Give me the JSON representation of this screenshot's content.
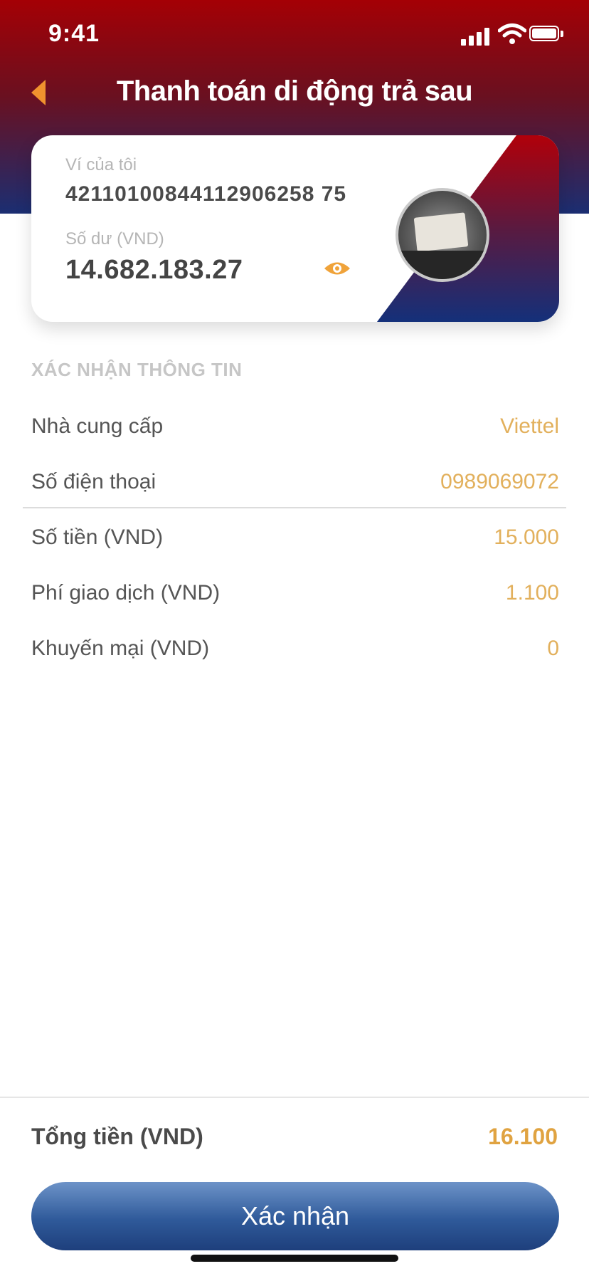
{
  "status": {
    "time": "9:41"
  },
  "nav": {
    "title": "Thanh toán di động trả sau"
  },
  "wallet": {
    "label": "Ví của tôi",
    "account_number": "42110100844112906258 75",
    "balance_label": "Số dư (VND)",
    "balance": "14.682.183.27"
  },
  "confirm_section": {
    "title": "XÁC NHẬN THÔNG TIN",
    "rows": [
      {
        "label": "Nhà cung cấp",
        "value": "Viettel"
      },
      {
        "label": "Số điện thoại",
        "value": "0989069072"
      },
      {
        "label": "Số tiền (VND)",
        "value": "15.000"
      },
      {
        "label": "Phí giao dịch (VND)",
        "value": "1.100"
      },
      {
        "label": "Khuyến mại (VND)",
        "value": "0"
      }
    ]
  },
  "total": {
    "label": "Tổng tiền (VND)",
    "value": "16.100"
  },
  "actions": {
    "confirm_label": "Xác nhận"
  },
  "colors": {
    "header_top": "#a40005",
    "header_bottom": "#1b2e72",
    "value_accent": "#e2b05c",
    "back_arrow": "#f0922e",
    "button": "#2f5a9a"
  },
  "icons": [
    "signal-icon",
    "wifi-icon",
    "battery-icon",
    "back-arrow-icon",
    "eye-icon",
    "avatar-image"
  ]
}
